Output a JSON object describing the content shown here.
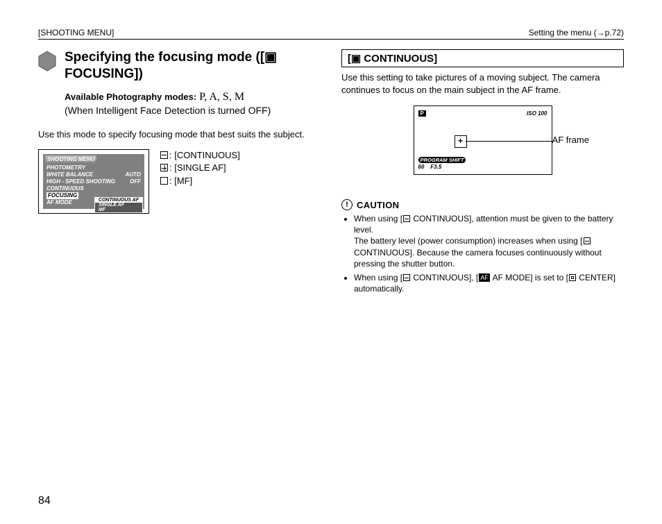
{
  "header": {
    "left": "[SHOOTING MENU]",
    "right": "Setting the menu (→p.72)"
  },
  "left_col": {
    "title": "Specifying the focusing mode ([▣ FOCUSING])",
    "modes_label": "Available Photography modes:",
    "modes_letters": "P, A, S, M",
    "modes_note": "(When Intelligent Face Detection is turned OFF)",
    "intro": "Use this mode to specify focusing mode that best suits the subject.",
    "menu": {
      "title": "SHOOTING MENU",
      "items": [
        {
          "left": "PHOTOMETRY",
          "right": ""
        },
        {
          "left": "WHITE BALANCE",
          "right": "AUTO"
        },
        {
          "left": "HIGH - SPEED SHOOTING",
          "right": "OFF"
        },
        {
          "left": "CONTINUOUS",
          "right": ""
        },
        {
          "left": "FOCUSING",
          "right": ""
        },
        {
          "left": "AF MODE",
          "right": ""
        }
      ],
      "sub": [
        "CONTINUOUS AF",
        "SINGLE AF",
        "MF"
      ]
    },
    "legend": {
      "continuous": ": [CONTINUOUS]",
      "single": ": [SINGLE AF]",
      "mf": ": [MF]"
    }
  },
  "right_col": {
    "header": "[▣ CONTINUOUS]",
    "body": "Use this setting to take pictures of a moving subject. The camera continues to focus on the main subject in the AF frame.",
    "af_fig": {
      "mode_badge": "P",
      "iso": "ISO 100",
      "program": "PROGRAM SHIFT",
      "shutter": "60",
      "aperture": "F3.5",
      "plus": "+",
      "label": "AF frame"
    },
    "caution_label": "CAUTION",
    "caution_items": [
      {
        "l1": "When using [",
        "l2": " CONTINUOUS], attention must be given to the battery level.",
        "l3": "The battery level (power consumption) increases when using [",
        "l4": " CONTINUOUS]. Because the camera focuses continuously without pressing the shutter button."
      },
      {
        "l1": "When using [",
        "l2": " CONTINUOUS], [",
        "l3": " AF MODE] is set to [",
        "l4": " CENTER] automatically."
      }
    ]
  },
  "page_number": "84"
}
